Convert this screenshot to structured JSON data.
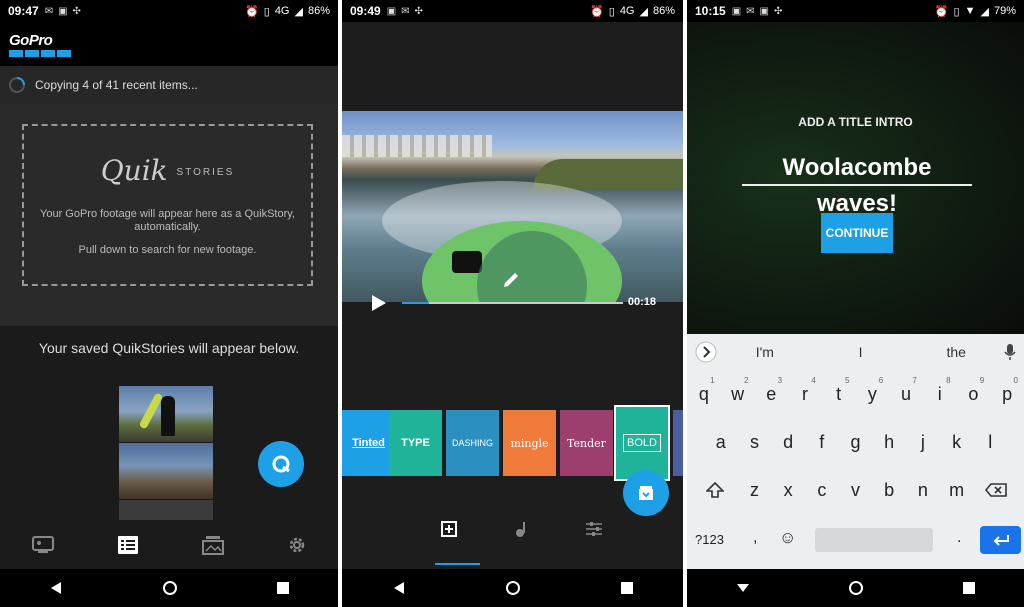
{
  "screen1": {
    "status": {
      "time": "09:47",
      "network": "4G",
      "battery": "86%"
    },
    "logo": "GoPro",
    "copy_status": "Copying 4 of 41 recent items...",
    "quik_logo_main": "Quik",
    "quik_logo_sub": "STORIES",
    "empty_line1": "Your GoPro footage will appear here as a QuikStory, automatically.",
    "empty_line2": "Pull down to search for new footage.",
    "saved_text": "Your saved QuikStories will appear below."
  },
  "screen2": {
    "status": {
      "time": "09:49",
      "network": "4G",
      "battery": "86%"
    },
    "video": {
      "duration": "00:18",
      "progress": 0.12
    },
    "themes": [
      {
        "label": "Tinted",
        "color": "#1ea0e6"
      },
      {
        "label": "TYPE",
        "color": "#1fb39a"
      },
      {
        "label": "DASHING",
        "color": "#2b8fbf"
      },
      {
        "label": "mingle",
        "color": "#f07a3a"
      },
      {
        "label": "Tender",
        "color": "#9c3f6e"
      },
      {
        "label": "BOLD",
        "color": "#1fb39a"
      }
    ]
  },
  "screen3": {
    "status": {
      "time": "10:15",
      "battery": "79%"
    },
    "intro_label": "ADD A TITLE INTRO",
    "title_value": "Woolacombe waves!",
    "continue_label": "CONTINUE",
    "suggestions": [
      "I'm",
      "I",
      "the"
    ],
    "keyboard": {
      "row1": [
        {
          "k": "q",
          "s": "1"
        },
        {
          "k": "w",
          "s": "2"
        },
        {
          "k": "e",
          "s": "3"
        },
        {
          "k": "r",
          "s": "4"
        },
        {
          "k": "t",
          "s": "5"
        },
        {
          "k": "y",
          "s": "6"
        },
        {
          "k": "u",
          "s": "7"
        },
        {
          "k": "i",
          "s": "8"
        },
        {
          "k": "o",
          "s": "9"
        },
        {
          "k": "p",
          "s": "0"
        }
      ],
      "row2": [
        "a",
        "s",
        "d",
        "f",
        "g",
        "h",
        "j",
        "k",
        "l"
      ],
      "row3": [
        "z",
        "x",
        "c",
        "v",
        "b",
        "n",
        "m"
      ],
      "symbols_key": "?123",
      "comma": ",",
      "period": "."
    }
  },
  "colors": {
    "accent": "#1ea0e6"
  }
}
